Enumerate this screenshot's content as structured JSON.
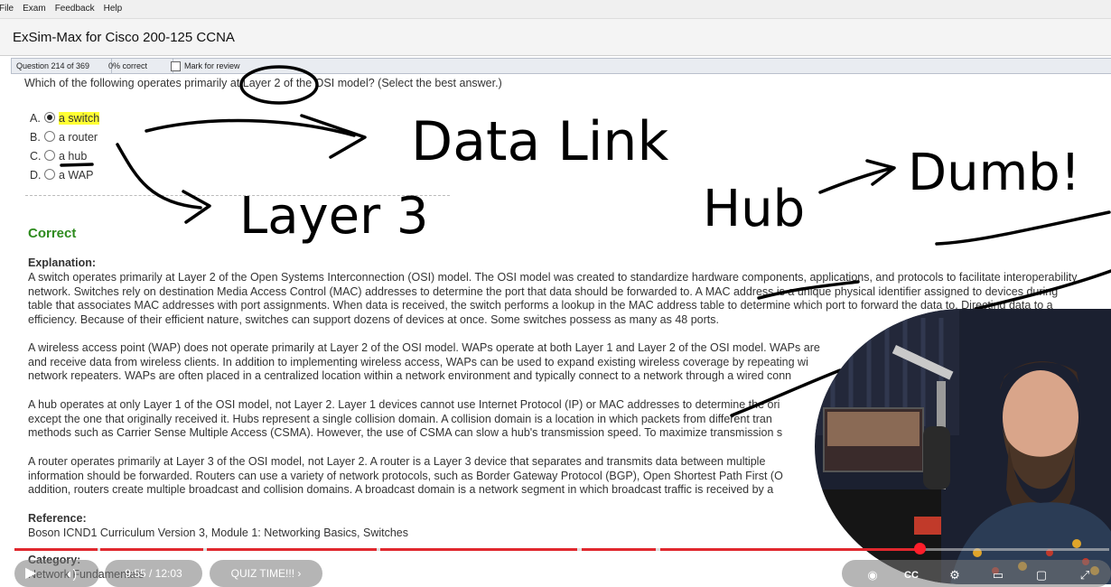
{
  "menu": [
    "File",
    "Exam",
    "Feedback",
    "Help"
  ],
  "window_title": "ExSim-Max for Cisco 200-125 CCNA",
  "status": {
    "question_counter": "Question 214 of 369",
    "score": "0% correct",
    "mark_label": "Mark for review"
  },
  "question": "Which of the following operates primarily at Layer 2 of the OSI model?  (Select the best answer.)",
  "options": [
    {
      "letter": "A.",
      "text": "a switch",
      "selected": true
    },
    {
      "letter": "B.",
      "text": "a router",
      "selected": false
    },
    {
      "letter": "C.",
      "text": "a hub",
      "selected": false
    },
    {
      "letter": "D.",
      "text": "a WAP",
      "selected": false
    }
  ],
  "result": "Correct",
  "explanation_heading": "Explanation:",
  "paragraphs": [
    [
      "A switch operates primarily at Layer 2 of the Open Systems Interconnection (OSI) model. The OSI model was created to standardize hardware components, applications, and protocols to facilitate interoperability",
      "network. Switches rely on destination Media Access Control (MAC) addresses to determine the port that data should be forwarded to. A MAC address is a unique physical identifier assigned to devices during",
      "table that associates MAC addresses with port assignments. When data is received, the switch performs a lookup in the MAC address table to determine which port to forward the data to. Directing data to a",
      "efficiency. Because of their efficient nature, switches can support dozens of devices at once. Some switches possess as many as 48 ports."
    ],
    [
      "A wireless access point (WAP) does not operate primarily at Layer 2 of the OSI model. WAPs operate at both Layer 1 and Layer 2 of the OSI model. WAPs are",
      "and receive data from wireless clients. In addition to implementing wireless access, WAPs can be used to expand existing wireless coverage by repeating wi",
      "network repeaters. WAPs are often placed in a centralized location within a network environment and typically connect to a network through a wired conn"
    ],
    [
      "A hub operates at only Layer 1 of the OSI model, not Layer 2. Layer 1 devices cannot use Internet Protocol (IP) or MAC addresses to determine the ori",
      "except the one that originally received it. Hubs represent a single collision domain. A collision domain is a location in which packets from different tran",
      "methods such as Carrier Sense Multiple Access (CSMA). However, the use of CSMA can slow a hub's transmission speed. To maximize transmission s"
    ],
    [
      "A router operates primarily at Layer 3 of the OSI model, not Layer 2. A router is a Layer 3 device that separates and transmits data between multiple",
      "information should be forwarded. Routers can use a variety of network protocols, such as Border Gateway Protocol (BGP), Open Shortest Path First (O",
      "addition, routers create multiple broadcast and collision domains. A broadcast domain is a network segment in which broadcast traffic is received by a"
    ]
  ],
  "reference_heading": "Reference:",
  "reference_text": "Boson ICND1 Curriculum Version 3, Module 1: Networking Basics, Switches",
  "category_heading": "Category:",
  "category_text": "Network Fundamentals",
  "annotations": {
    "note1": "Data Link",
    "note2": "Layer 3",
    "note3": "Hub",
    "note4": "Dumb!"
  },
  "video": {
    "time": "9:55 / 12:03",
    "chapter": "QUIZ TIME!!! ›",
    "cc_label": "CC",
    "progress": 0.824
  },
  "colors": {
    "correct": "#2e8b1e",
    "highlight": "#ffff33",
    "progress": "#e0282e"
  }
}
